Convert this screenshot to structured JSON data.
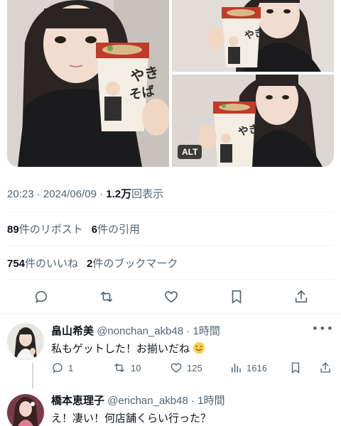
{
  "post": {
    "alt_badge": "ALT",
    "timestamp": "20:23 · 2024/06/09 · ",
    "views_count": "1.2万",
    "views_label": "回表示",
    "reposts_count": "89",
    "reposts_label": "件のリポスト",
    "quotes_count": "6",
    "quotes_label": "件の引用",
    "likes_count": "754",
    "likes_label": "件のいいね",
    "bookmarks_count": "2",
    "bookmarks_label": "件のブックマーク",
    "photos": [
      {
        "cup_text": "やきそば"
      },
      {
        "cup_text": "やきそば"
      },
      {
        "cup_text": "やきそば"
      }
    ]
  },
  "actions": {
    "icons": [
      "reply-icon",
      "repost-icon",
      "like-icon",
      "bookmark-icon",
      "share-icon"
    ]
  },
  "replies": [
    {
      "name": "畠山希美",
      "handle": "@nonchan_akb48",
      "time": "· 1時間",
      "text": "私もゲットした！お揃いだね",
      "emoji": "relaxed-face-emoji",
      "reply_count": "1",
      "repost_count": "10",
      "like_count": "125",
      "view_count": "1616"
    },
    {
      "name": "橋本恵理子",
      "handle": "@erichan_akb48",
      "time": "· 1時間",
      "text": "え！凄い！何店舗くらい行った？"
    }
  ],
  "colors": {
    "text": "#0f1419",
    "secondary": "#536471",
    "divider": "#eff3f4"
  }
}
